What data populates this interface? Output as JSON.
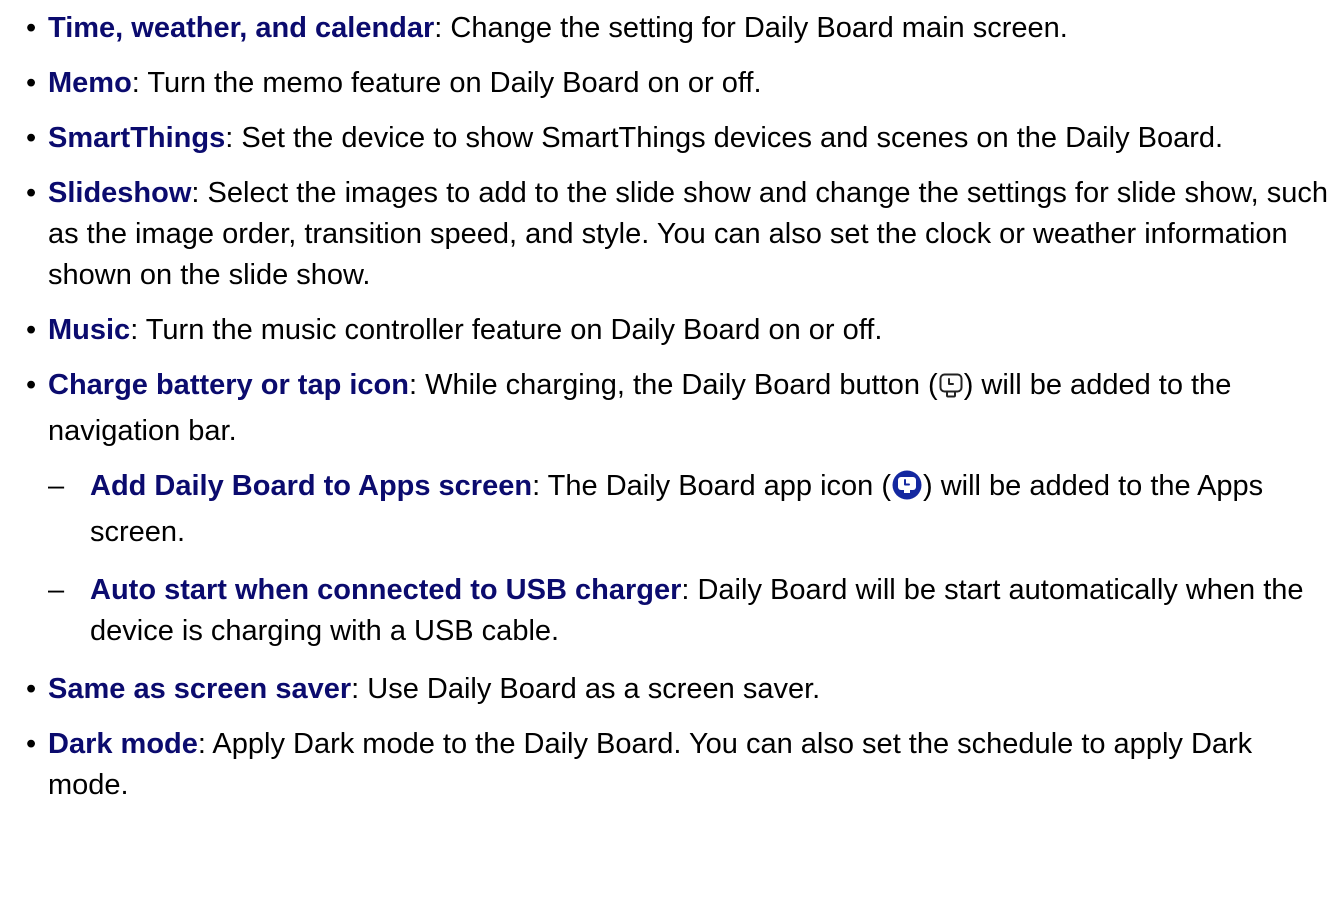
{
  "list": {
    "bullet": "•",
    "dash": "–",
    "items": [
      {
        "term": "Time, weather, and calendar",
        "sep": ": ",
        "desc": "Change the setting for Daily Board main screen."
      },
      {
        "term": "Memo",
        "sep": ": ",
        "desc": "Turn the memo feature on Daily Board on or off."
      },
      {
        "term": "SmartThings",
        "sep": ": ",
        "desc": "Set the device to show SmartThings devices and scenes on the Daily Board."
      },
      {
        "term": "Slideshow",
        "sep": ": ",
        "desc": "Select the images to add to the slide show and change the settings for slide show, such as the image order, transition speed, and style. You can also set the clock or weather information shown on the slide show."
      },
      {
        "term": "Music",
        "sep": ": ",
        "desc": "Turn the music controller feature on Daily Board on or off."
      },
      {
        "term": "Charge battery or tap icon",
        "sep": ": ",
        "desc_before": "While charging, the Daily Board button (",
        "desc_after": ") will be added to the navigation bar."
      },
      {
        "term": "Add Daily Board to Apps screen",
        "sep": ": ",
        "desc_before": "The Daily Board app icon (",
        "desc_after": ") will be added to the Apps screen."
      },
      {
        "term": "Auto start when connected to USB charger",
        "sep": ": ",
        "desc": "Daily Board will be start automatically when the device is charging with a USB cable."
      },
      {
        "term": "Same as screen saver",
        "sep": ": ",
        "desc": "Use Daily Board as a screen saver."
      },
      {
        "term": "Dark mode",
        "sep": ": ",
        "desc": "Apply Dark mode to the Daily Board. You can also set the schedule to apply Dark mode."
      }
    ]
  },
  "icons": {
    "daily_board_button": "daily-board-button-icon",
    "daily_board_app": "daily-board-app-icon",
    "app_icon_color": "#1428a0"
  }
}
